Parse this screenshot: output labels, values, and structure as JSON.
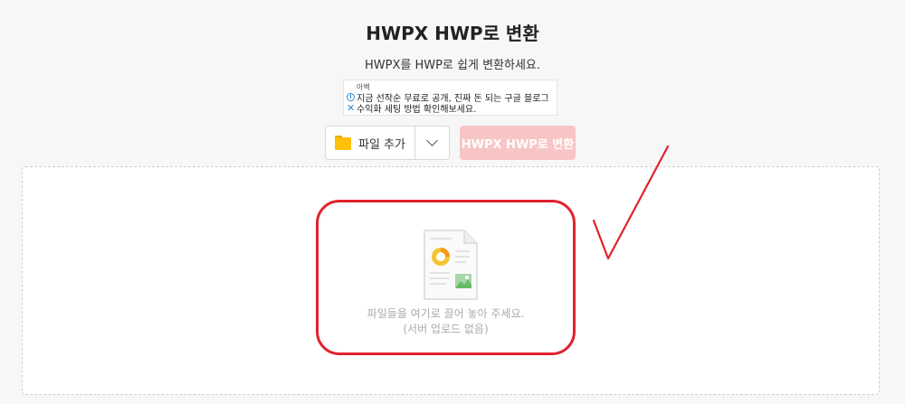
{
  "header": {
    "title": "HWPX HWP로 변환",
    "subtitle": "HWPX를 HWP로 쉽게 변환하세요."
  },
  "ad": {
    "label": "아벡",
    "line1": "지금 선작순 무료로 공개, 진짜 돈 되는 구글 블로그",
    "line2": "수익화 세팅 방법 확인해보세요.",
    "info_icon": "i",
    "close_icon": "✕"
  },
  "toolbar": {
    "file_add_label": "파일 추가",
    "convert_label": "HWPX HWP로 변환",
    "convert_color": "#f7c5c5"
  },
  "dropzone": {
    "line1": "파일들을 여기로 끌어 놓아 주세요.",
    "line2": "(서버 업로드 없음)"
  },
  "colors": {
    "highlight": "#e0232e",
    "folder": "#ffc107",
    "accent_blue": "#2f8bd6"
  }
}
